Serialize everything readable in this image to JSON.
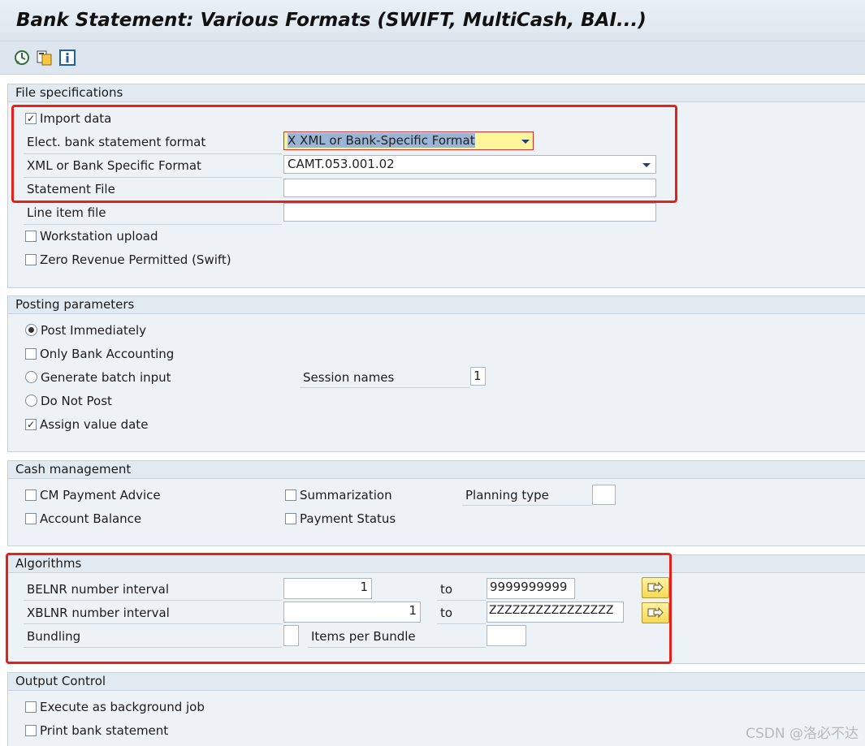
{
  "window": {
    "title": "Bank Statement: Various Formats (SWIFT, MultiCash, BAI...)"
  },
  "toolbar": {
    "icons": [
      "execute-icon",
      "variant-icon",
      "info-icon"
    ]
  },
  "file_spec": {
    "header": "File specifications",
    "import_data": {
      "label": "Import data",
      "checked": true
    },
    "elect_format": {
      "label": "Elect. bank statement format",
      "value": "X XML or Bank-Specific Format"
    },
    "xml_format": {
      "label": "XML or Bank Specific Format",
      "value": "CAMT.053.001.02"
    },
    "statement_file": {
      "label": "Statement File",
      "value": ""
    },
    "line_item_file": {
      "label": "Line item file",
      "value": ""
    },
    "workstation_upload": {
      "label": "Workstation upload",
      "checked": false
    },
    "zero_revenue": {
      "label": "Zero Revenue Permitted (Swift)",
      "checked": false
    }
  },
  "posting": {
    "header": "Posting parameters",
    "post_immediately": {
      "label": "Post Immediately",
      "selected": true
    },
    "only_bank_accounting": {
      "label": "Only Bank Accounting",
      "checked": false
    },
    "generate_batch": {
      "label": "Generate batch input",
      "selected": false
    },
    "do_not_post": {
      "label": "Do Not Post",
      "selected": false
    },
    "assign_value_date": {
      "label": "Assign value date",
      "checked": true
    },
    "session_names": {
      "label": "Session names",
      "value": "1"
    }
  },
  "cash": {
    "header": "Cash management",
    "cm_payment_advice": {
      "label": "CM Payment Advice",
      "checked": false
    },
    "account_balance": {
      "label": "Account Balance",
      "checked": false
    },
    "summarization": {
      "label": "Summarization",
      "checked": false
    },
    "payment_status": {
      "label": "Payment Status",
      "checked": false
    },
    "planning_type": {
      "label": "Planning type",
      "value": ""
    }
  },
  "algorithms": {
    "header": "Algorithms",
    "belnr": {
      "label": "BELNR number interval",
      "from": "1",
      "to_label": "to",
      "to": "9999999999"
    },
    "xblnr": {
      "label": "XBLNR number interval",
      "from": "1",
      "to_label": "to",
      "to": "ZZZZZZZZZZZZZZZZ"
    },
    "bundling": {
      "label": "Bundling",
      "value": ""
    },
    "items_per_bundle": {
      "label": "Items per Bundle",
      "value": ""
    }
  },
  "output": {
    "header": "Output Control",
    "background_job": {
      "label": "Execute as background job",
      "checked": false
    },
    "print_statement": {
      "label": "Print bank statement",
      "checked": false
    }
  },
  "watermark": "CSDN @洛必不达",
  "colors": {
    "highlight": "#e8201a",
    "dropdown_focus": "#fff59a",
    "frame_bg": "#edf2f7"
  }
}
